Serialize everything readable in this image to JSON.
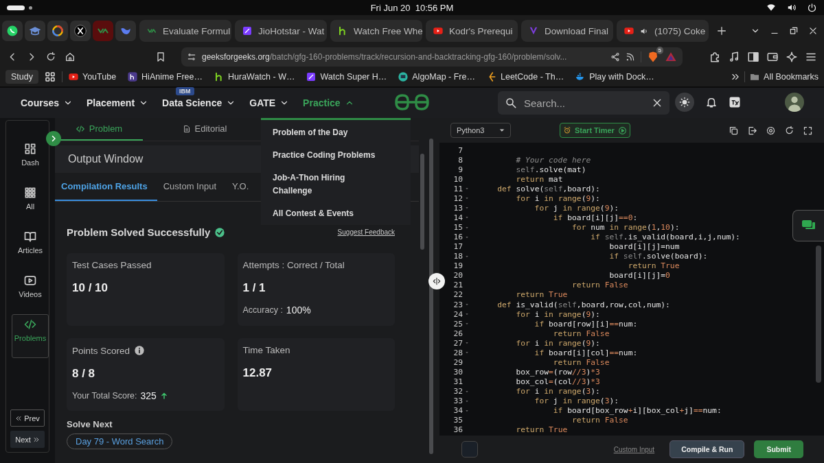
{
  "system_bar": {
    "datetime": "Fri Jun 20  10:56 PM"
  },
  "browser": {
    "pinned_tabs": [
      {
        "selected": false
      },
      {
        "selected": false
      },
      {
        "selected": false
      },
      {
        "selected": false
      },
      {
        "selected": true
      },
      {
        "selected": false
      }
    ],
    "tabs": [
      {
        "title": "Evaluate Formul",
        "audio": false
      },
      {
        "title": "JioHotstar - Wat",
        "audio": false
      },
      {
        "title": "Watch Free Whe",
        "audio": false
      },
      {
        "title": "Kodr's Prerequi",
        "audio": false
      },
      {
        "title": "Download Final",
        "audio": false
      },
      {
        "title": "(1075) Coke ",
        "audio": true
      }
    ],
    "url": {
      "domain": "geeksforgeeks.org",
      "path": "/batch/gfg-160-problems/track/recursion-and-backtracking-gfg-160/problem/solv..."
    },
    "shield_badge": "5",
    "bookmark_folder": "Study",
    "bookmarks": [
      "YouTube",
      "HiAnime Free…",
      "HuraWatch - W…",
      "Watch Super H…",
      "AlgoMap - Fre…",
      "LeetCode - Th…",
      "Play with Dock…"
    ],
    "all_bookmarks": "All Bookmarks"
  },
  "nav": [
    {
      "label": "Courses",
      "expanded": false
    },
    {
      "label": "Placement",
      "expanded": false
    },
    {
      "label": "Data Science",
      "expanded": false,
      "badge": "IBM"
    },
    {
      "label": "GATE",
      "expanded": false
    },
    {
      "label": "Practice",
      "expanded": true
    }
  ],
  "search": {
    "placeholder": "Search..."
  },
  "practice_menu": [
    "Problem of the Day",
    "Practice Coding Problems",
    "Job-A-Thon Hiring Challenge",
    "All Contest & Events"
  ],
  "rail": {
    "items": [
      {
        "label": "Dash",
        "selected": false
      },
      {
        "label": "All",
        "selected": false
      },
      {
        "label": "Articles",
        "selected": false
      },
      {
        "label": "Videos",
        "selected": false
      },
      {
        "label": "Problems",
        "selected": true
      }
    ],
    "prev": "Prev",
    "next": "Next"
  },
  "problem_tabs": [
    {
      "label": "Problem",
      "selected": true
    },
    {
      "label": "Editorial",
      "selected": false
    }
  ],
  "output": {
    "title": "Output Window",
    "tabs": [
      {
        "label": "Compilation Results",
        "selected": true
      },
      {
        "label": "Custom Input",
        "selected": false
      },
      {
        "label": "Y.O.",
        "selected": false
      }
    ],
    "status": "Problem Solved Successfully",
    "feedback": "Suggest Feedback",
    "cards": [
      {
        "label": "Test Cases Passed",
        "value": "10 / 10",
        "info": false
      },
      {
        "label": "Attempts : Correct / Total",
        "value": "1 / 1",
        "info": false,
        "note_label": "Accuracy :",
        "note_value": "100%",
        "rising": false
      },
      {
        "label": "Points Scored",
        "value": "8 / 8",
        "info": true,
        "note_label": "Your Total Score:",
        "note_value": "325",
        "rising": true
      },
      {
        "label": "Time Taken",
        "value": "12.87",
        "info": false
      }
    ],
    "solve_next": {
      "title": "Solve Next",
      "items": [
        "Day 79 - Word Search"
      ]
    }
  },
  "editor": {
    "language": "Python3",
    "timer": "Start Timer",
    "custom_input": "Custom Input",
    "compile": "Compile & Run",
    "submit": "Submit",
    "lines": [
      {
        "n": "7",
        "fold": false
      },
      {
        "n": "8",
        "fold": false,
        "t": [
          {
            "kind": "comment",
            "text": "        # Your code here"
          }
        ]
      },
      {
        "n": "9",
        "fold": false,
        "t": [
          {
            "kind": "self",
            "text": "        self"
          },
          {
            "kind": "plain",
            "text": ".solve(mat)"
          }
        ]
      },
      {
        "n": "10",
        "fold": false,
        "t": [
          {
            "kind": "keyword",
            "text": "        return "
          },
          {
            "kind": "plain",
            "text": "mat"
          }
        ]
      },
      {
        "n": "11",
        "fold": true,
        "t": [
          {
            "kind": "keyword",
            "text": "    def "
          },
          {
            "kind": "plain",
            "text": "solve("
          },
          {
            "kind": "self",
            "text": "self"
          },
          {
            "kind": "plain",
            "text": ",board):"
          }
        ]
      },
      {
        "n": "12",
        "fold": true,
        "t": [
          {
            "kind": "keyword",
            "text": "        for "
          },
          {
            "kind": "plain",
            "text": "i "
          },
          {
            "kind": "keyword",
            "text": "in range"
          },
          {
            "kind": "plain",
            "text": "("
          },
          {
            "kind": "number",
            "text": "9"
          },
          {
            "kind": "plain",
            "text": "):"
          }
        ]
      },
      {
        "n": "13",
        "fold": true,
        "t": [
          {
            "kind": "keyword",
            "text": "            for "
          },
          {
            "kind": "plain",
            "text": "j "
          },
          {
            "kind": "keyword",
            "text": "in range"
          },
          {
            "kind": "plain",
            "text": "("
          },
          {
            "kind": "number",
            "text": "9"
          },
          {
            "kind": "plain",
            "text": "):"
          }
        ]
      },
      {
        "n": "14",
        "fold": true,
        "t": [
          {
            "kind": "keyword",
            "text": "                if "
          },
          {
            "kind": "plain",
            "text": "board[i][j]"
          },
          {
            "kind": "number",
            "text": "==0"
          },
          {
            "kind": "plain",
            "text": ":"
          }
        ]
      },
      {
        "n": "15",
        "fold": true,
        "t": [
          {
            "kind": "keyword",
            "text": "                    for "
          },
          {
            "kind": "plain",
            "text": "num "
          },
          {
            "kind": "keyword",
            "text": "in range"
          },
          {
            "kind": "plain",
            "text": "("
          },
          {
            "kind": "number",
            "text": "1"
          },
          {
            "kind": "plain",
            "text": ","
          },
          {
            "kind": "number",
            "text": "10"
          },
          {
            "kind": "plain",
            "text": "):"
          }
        ]
      },
      {
        "n": "16",
        "fold": true,
        "t": [
          {
            "kind": "keyword",
            "text": "                        if "
          },
          {
            "kind": "self",
            "text": "self"
          },
          {
            "kind": "plain",
            "text": ".is_valid(board,i,j,num):"
          }
        ]
      },
      {
        "n": "17",
        "fold": false,
        "t": [
          {
            "kind": "plain",
            "text": "                            board[i][j]=num"
          }
        ]
      },
      {
        "n": "18",
        "fold": true,
        "t": [
          {
            "kind": "keyword",
            "text": "                            if "
          },
          {
            "kind": "self",
            "text": "self"
          },
          {
            "kind": "plain",
            "text": ".solve(board):"
          }
        ]
      },
      {
        "n": "19",
        "fold": false,
        "t": [
          {
            "kind": "keyword",
            "text": "                                return "
          },
          {
            "kind": "number",
            "text": "True"
          }
        ]
      },
      {
        "n": "20",
        "fold": false,
        "t": [
          {
            "kind": "plain",
            "text": "                            board[i][j]="
          },
          {
            "kind": "number",
            "text": "0"
          }
        ]
      },
      {
        "n": "21",
        "fold": false,
        "t": [
          {
            "kind": "keyword",
            "text": "                    return "
          },
          {
            "kind": "number",
            "text": "False"
          }
        ]
      },
      {
        "n": "22",
        "fold": false,
        "t": [
          {
            "kind": "keyword",
            "text": "        return "
          },
          {
            "kind": "number",
            "text": "True"
          }
        ]
      },
      {
        "n": "23",
        "fold": true,
        "t": [
          {
            "kind": "keyword",
            "text": "    def "
          },
          {
            "kind": "plain",
            "text": "is_valid("
          },
          {
            "kind": "self",
            "text": "self"
          },
          {
            "kind": "plain",
            "text": ",board,row,col,num):"
          }
        ]
      },
      {
        "n": "24",
        "fold": true,
        "t": [
          {
            "kind": "keyword",
            "text": "        for "
          },
          {
            "kind": "plain",
            "text": "i "
          },
          {
            "kind": "keyword",
            "text": "in range"
          },
          {
            "kind": "plain",
            "text": "("
          },
          {
            "kind": "number",
            "text": "9"
          },
          {
            "kind": "plain",
            "text": "):"
          }
        ]
      },
      {
        "n": "25",
        "fold": true,
        "t": [
          {
            "kind": "keyword",
            "text": "            if "
          },
          {
            "kind": "plain",
            "text": "board[row][i]"
          },
          {
            "kind": "number",
            "text": "=="
          },
          {
            "kind": "plain",
            "text": "num:"
          }
        ]
      },
      {
        "n": "26",
        "fold": false,
        "t": [
          {
            "kind": "keyword",
            "text": "                return "
          },
          {
            "kind": "number",
            "text": "False"
          }
        ]
      },
      {
        "n": "27",
        "fold": true,
        "t": [
          {
            "kind": "keyword",
            "text": "        for "
          },
          {
            "kind": "plain",
            "text": "i "
          },
          {
            "kind": "keyword",
            "text": "in range"
          },
          {
            "kind": "plain",
            "text": "("
          },
          {
            "kind": "number",
            "text": "9"
          },
          {
            "kind": "plain",
            "text": "):"
          }
        ]
      },
      {
        "n": "28",
        "fold": true,
        "t": [
          {
            "kind": "keyword",
            "text": "            if "
          },
          {
            "kind": "plain",
            "text": "board[i][col]"
          },
          {
            "kind": "number",
            "text": "=="
          },
          {
            "kind": "plain",
            "text": "num:"
          }
        ]
      },
      {
        "n": "29",
        "fold": false,
        "t": [
          {
            "kind": "keyword",
            "text": "                return "
          },
          {
            "kind": "number",
            "text": "False"
          }
        ]
      },
      {
        "n": "30",
        "fold": false,
        "t": [
          {
            "kind": "plain",
            "text": "        box_row"
          },
          {
            "kind": "number",
            "text": "="
          },
          {
            "kind": "plain",
            "text": "(row"
          },
          {
            "kind": "number",
            "text": "//3"
          },
          {
            "kind": "plain",
            "text": ")"
          },
          {
            "kind": "number",
            "text": "*3"
          }
        ]
      },
      {
        "n": "31",
        "fold": false,
        "t": [
          {
            "kind": "plain",
            "text": "        box_col"
          },
          {
            "kind": "number",
            "text": "="
          },
          {
            "kind": "plain",
            "text": "(col"
          },
          {
            "kind": "number",
            "text": "//3"
          },
          {
            "kind": "plain",
            "text": ")"
          },
          {
            "kind": "number",
            "text": "*3"
          }
        ]
      },
      {
        "n": "32",
        "fold": true,
        "t": [
          {
            "kind": "keyword",
            "text": "        for "
          },
          {
            "kind": "plain",
            "text": "i "
          },
          {
            "kind": "keyword",
            "text": "in range"
          },
          {
            "kind": "plain",
            "text": "("
          },
          {
            "kind": "number",
            "text": "3"
          },
          {
            "kind": "plain",
            "text": "):"
          }
        ]
      },
      {
        "n": "33",
        "fold": true,
        "t": [
          {
            "kind": "keyword",
            "text": "            for "
          },
          {
            "kind": "plain",
            "text": "j "
          },
          {
            "kind": "keyword",
            "text": "in range"
          },
          {
            "kind": "plain",
            "text": "("
          },
          {
            "kind": "number",
            "text": "3"
          },
          {
            "kind": "plain",
            "text": "):"
          }
        ]
      },
      {
        "n": "34",
        "fold": true,
        "t": [
          {
            "kind": "keyword",
            "text": "                if "
          },
          {
            "kind": "plain",
            "text": "board[box_row"
          },
          {
            "kind": "number",
            "text": "+"
          },
          {
            "kind": "plain",
            "text": "i][box_col"
          },
          {
            "kind": "number",
            "text": "+"
          },
          {
            "kind": "plain",
            "text": "j]"
          },
          {
            "kind": "number",
            "text": "=="
          },
          {
            "kind": "plain",
            "text": "num:"
          }
        ]
      },
      {
        "n": "35",
        "fold": false,
        "t": [
          {
            "kind": "keyword",
            "text": "                    return "
          },
          {
            "kind": "number",
            "text": "False"
          }
        ]
      },
      {
        "n": "36",
        "fold": false,
        "t": [
          {
            "kind": "keyword",
            "text": "        return "
          },
          {
            "kind": "number",
            "text": "True"
          }
        ]
      }
    ]
  }
}
